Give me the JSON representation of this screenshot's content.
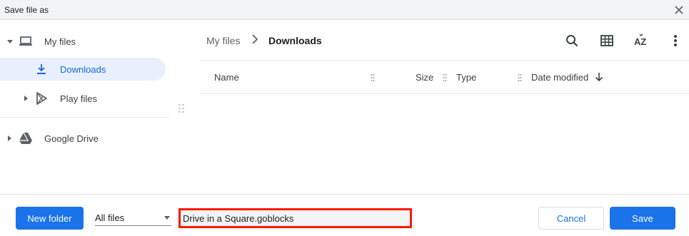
{
  "window": {
    "title": "Save file as"
  },
  "sidebar": {
    "items": [
      {
        "label": "My files",
        "icon": "laptop-icon",
        "expanded": true
      },
      {
        "label": "Downloads",
        "icon": "download-icon",
        "selected": true
      },
      {
        "label": "Play files",
        "icon": "play-store-icon",
        "expanded": false
      },
      {
        "label": "Google Drive",
        "icon": "google-drive-icon",
        "expanded": false
      }
    ]
  },
  "breadcrumb": {
    "root": "My files",
    "current": "Downloads"
  },
  "toolbar": {
    "icons": [
      "search-icon",
      "grid-view-icon",
      "sort-az-icon",
      "more-vert-icon"
    ]
  },
  "table": {
    "columns": [
      "Name",
      "Size",
      "Type",
      "Date modified"
    ],
    "sort": {
      "column": "Date modified",
      "direction": "descending"
    },
    "rows": []
  },
  "footer": {
    "new_folder_label": "New folder",
    "file_type_value": "All files",
    "filename_value": "Drive in a Square.goblocks",
    "cancel_label": "Cancel",
    "save_label": "Save"
  },
  "colors": {
    "accent": "#1a73e8",
    "selected_bg": "#e8f0fe",
    "highlight_border": "#ff1a00"
  }
}
